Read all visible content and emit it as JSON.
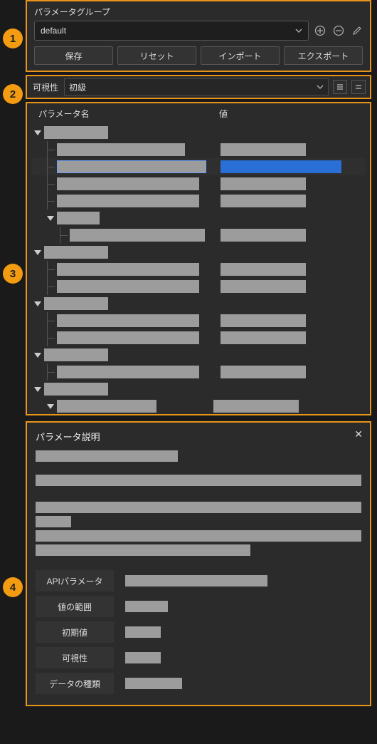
{
  "section1": {
    "title": "パラメータグループ",
    "group_selected": "default",
    "icons": {
      "add": "plus-circle",
      "remove": "minus-circle",
      "edit": "pencil"
    },
    "buttons": {
      "save": "保存",
      "reset": "リセット",
      "import": "インポート",
      "export": "エクスポート"
    }
  },
  "section2": {
    "label": "可視性",
    "selected": "初級"
  },
  "section3": {
    "headers": {
      "name": "パラメータ名",
      "value": "値"
    }
  },
  "section4": {
    "title": "パラメータ説明",
    "table": {
      "api": "APIパラメータ",
      "range": "値の範囲",
      "default": "初期値",
      "visibility": "可視性",
      "dtype": "データの種類"
    }
  },
  "labels": {
    "n1": "1",
    "n2": "2",
    "n3": "3",
    "n4": "4"
  }
}
